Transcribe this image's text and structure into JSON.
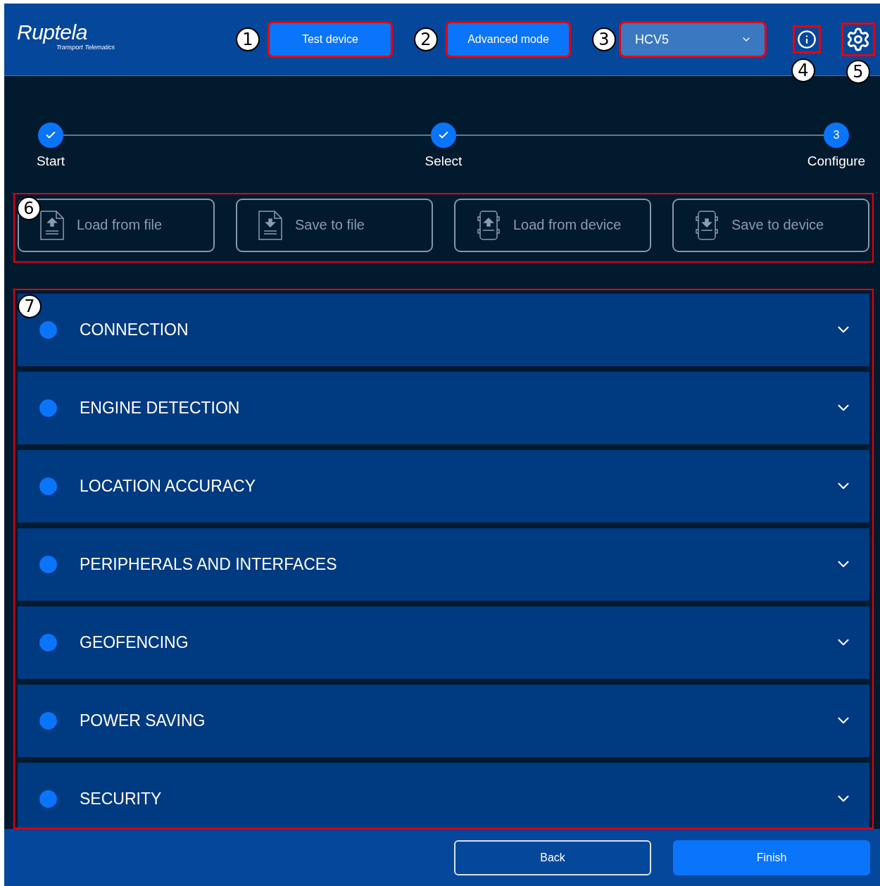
{
  "header": {
    "logo": {
      "name": "Ruptela",
      "tagline": "Transport Telematics"
    },
    "buttons": [
      {
        "label": "Test device",
        "callout": "1"
      },
      {
        "label": "Advanced mode",
        "callout": "2"
      }
    ],
    "device_select": {
      "value": "HCV5",
      "callout": "3"
    },
    "info_button": {
      "callout": "4"
    },
    "settings_button": {
      "callout": "5"
    }
  },
  "stepper": {
    "steps": [
      {
        "label": "Start",
        "kind": "done"
      },
      {
        "label": "Select",
        "kind": "done"
      },
      {
        "label": "Configure",
        "kind": "current",
        "number": "3"
      }
    ]
  },
  "file_actions": {
    "callout": "6",
    "buttons": [
      {
        "label": "Load from file",
        "kind": "file-load"
      },
      {
        "label": "Save to file",
        "kind": "file-save"
      },
      {
        "label": "Load from device",
        "kind": "device-load"
      },
      {
        "label": "Save to device",
        "kind": "device-save"
      }
    ]
  },
  "sections": {
    "callout": "7",
    "items": [
      {
        "title": "CONNECTION",
        "expanded": false
      },
      {
        "title": "ENGINE DETECTION",
        "expanded": false
      },
      {
        "title": "LOCATION ACCURACY",
        "expanded": false
      },
      {
        "title": "PERIPHERALS AND INTERFACES",
        "expanded": false
      },
      {
        "title": "GEOFENCING",
        "expanded": false
      },
      {
        "title": "POWER SAVING",
        "expanded": false
      },
      {
        "title": "SECURITY",
        "expanded": false
      }
    ]
  },
  "footer": {
    "buttons": [
      {
        "label": "Back",
        "kind": "outline"
      },
      {
        "label": "Finish",
        "kind": "primary"
      }
    ]
  }
}
